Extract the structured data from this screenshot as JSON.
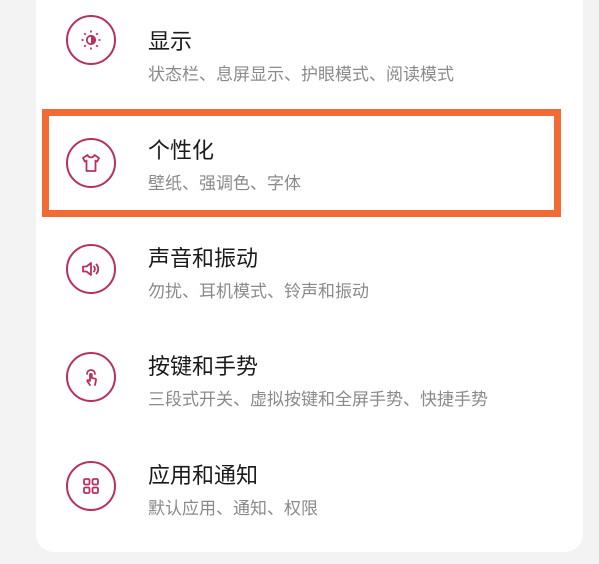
{
  "settings": {
    "items": [
      {
        "title": "显示",
        "subtitle": "状态栏、息屏显示、护眼模式、阅读模式",
        "icon": "brightness-icon"
      },
      {
        "title": "个性化",
        "subtitle": "壁纸、强调色、字体",
        "icon": "tshirt-icon"
      },
      {
        "title": "声音和振动",
        "subtitle": "勿扰、耳机模式、铃声和振动",
        "icon": "speaker-icon"
      },
      {
        "title": "按键和手势",
        "subtitle": "三段式开关、虚拟按键和全屏手势、快捷手势",
        "icon": "touch-gesture-icon"
      },
      {
        "title": "应用和通知",
        "subtitle": "默认应用、通知、权限",
        "icon": "apps-grid-icon"
      }
    ]
  },
  "colors": {
    "accent": "#b8315c",
    "highlight_border": "#f26b35"
  }
}
